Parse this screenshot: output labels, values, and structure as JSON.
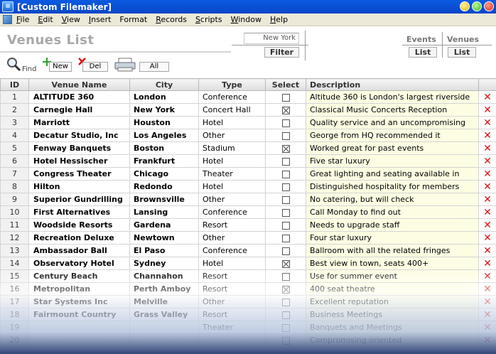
{
  "window": {
    "title": "[Custom Filemaker]"
  },
  "menu": [
    {
      "label_u": "F",
      "label_rest": "ile"
    },
    {
      "label_u": "E",
      "label_rest": "dit"
    },
    {
      "label_u": "V",
      "label_rest": "iew"
    },
    {
      "label_u": "I",
      "label_rest": "nsert"
    },
    {
      "label_u": "F",
      "label_rest": "ormat",
      "prefix": "",
      "full": "Format"
    },
    {
      "label_u": "R",
      "label_rest": "ecords"
    },
    {
      "label_u": "S",
      "label_rest": "cripts"
    },
    {
      "label_u": "W",
      "label_rest": "indow"
    },
    {
      "label_u": "H",
      "label_rest": "elp"
    }
  ],
  "header": {
    "page_title": "Venues List",
    "search_value": "New York",
    "filter_label": "Filter",
    "events_label": "Events",
    "venues_label": "Venues",
    "list_label": "List",
    "find_label": "Find",
    "new_label": "New",
    "del_label": "Del",
    "all_label": "All"
  },
  "table": {
    "headers": {
      "id": "ID",
      "name": "Venue Name",
      "city": "City",
      "type": "Type",
      "select": "Select",
      "description": "Description"
    },
    "rows": [
      {
        "id": "1",
        "name": "ALTITUDE 360",
        "city": "London",
        "type": "Conference",
        "selected": false,
        "description": "Altitude 360 is London's largest riverside"
      },
      {
        "id": "2",
        "name": "Carnegie Hall",
        "city": "New York",
        "type": "Concert Hall",
        "selected": true,
        "description": "Classical Music Concerts Reception"
      },
      {
        "id": "3",
        "name": "Marriott",
        "city": "Houston",
        "type": "Hotel",
        "selected": false,
        "description": "Quality service and an uncompromising"
      },
      {
        "id": "4",
        "name": "Decatur Studio, Inc",
        "city": "Los Angeles",
        "type": "Other",
        "selected": false,
        "description": "George from HQ recommended it"
      },
      {
        "id": "5",
        "name": "Fenway Banquets",
        "city": "Boston",
        "type": "Stadium",
        "selected": true,
        "description": "Worked great for past events"
      },
      {
        "id": "6",
        "name": "Hotel Hessischer",
        "city": "Frankfurt",
        "type": "Hotel",
        "selected": false,
        "description": "Five star luxury"
      },
      {
        "id": "7",
        "name": "Congress Theater",
        "city": "Chicago",
        "type": "Theater",
        "selected": false,
        "description": "Great lighting and seating available in"
      },
      {
        "id": "8",
        "name": "Hilton",
        "city": "Redondo",
        "type": "Hotel",
        "selected": false,
        "description": "Distinguished hospitality for members"
      },
      {
        "id": "9",
        "name": "Superior Gundrilling",
        "city": "Brownsville",
        "type": "Other",
        "selected": false,
        "description": "No catering, but will check"
      },
      {
        "id": "10",
        "name": "First  Alternatives",
        "city": "Lansing",
        "type": "Conference",
        "selected": false,
        "description": "Call Monday to find out"
      },
      {
        "id": "11",
        "name": "Woodside Resorts",
        "city": "Gardena",
        "type": "Resort",
        "selected": false,
        "description": "Needs to upgrade staff"
      },
      {
        "id": "12",
        "name": "Recreation Deluxe",
        "city": "Newtown",
        "type": "Other",
        "selected": false,
        "description": "Four star luxury"
      },
      {
        "id": "13",
        "name": "Ambassador Ball",
        "city": "El Paso",
        "type": "Conference",
        "selected": false,
        "description": "Ballroom with all the related fringes"
      },
      {
        "id": "14",
        "name": "Observatory Hotel",
        "city": "Sydney",
        "type": "Hotel",
        "selected": true,
        "description": "Best view in town, seats 400+"
      },
      {
        "id": "15",
        "name": "Century Beach",
        "city": "Channahon",
        "type": "Resort",
        "selected": false,
        "description": "Use for summer event"
      },
      {
        "id": "16",
        "name": "Metropolitan",
        "city": "Perth Amboy",
        "type": "Resort",
        "selected": true,
        "description": "400 seat theatre"
      },
      {
        "id": "17",
        "name": "Star Systems Inc",
        "city": "Melville",
        "type": "Other",
        "selected": false,
        "description": "Excellent reputation"
      },
      {
        "id": "18",
        "name": "Fairmount Country",
        "city": "Grass Valley",
        "type": "Resort",
        "selected": false,
        "description": "Business Meetings"
      },
      {
        "id": "19",
        "name": "",
        "city": "",
        "type": "Theater",
        "selected": false,
        "description": "Banquets and Meetings"
      },
      {
        "id": "20",
        "name": "",
        "city": "",
        "type": "",
        "selected": false,
        "description": "Compromising oriented"
      }
    ]
  },
  "colors": {
    "title_bar": "#0a5be0",
    "delete_icon": "#e01010",
    "description_bg": "#fdfde3"
  }
}
